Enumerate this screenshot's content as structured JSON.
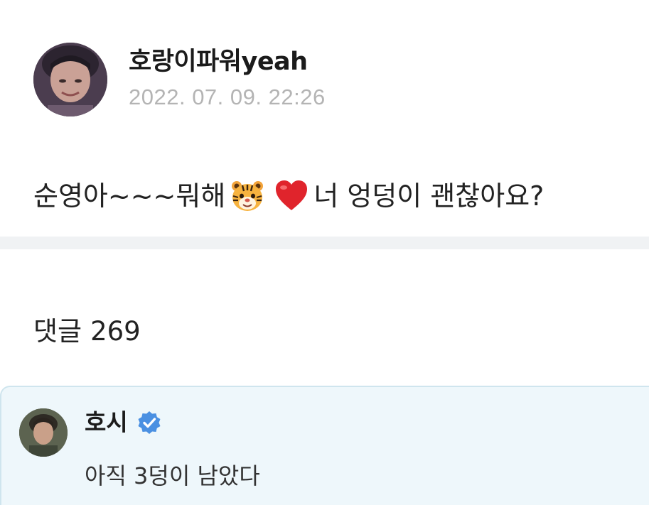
{
  "post": {
    "author": "호랑이파워yeah",
    "date": "2022. 07. 09. 22:26",
    "avatar_icon": "user-avatar-photo",
    "body_start": "순영아~~~뭐해",
    "body_emoji_1": "tiger-face",
    "body_emoji_2": "red-heart",
    "body_end": "너 엉덩이 괜찮아요?"
  },
  "comments": {
    "label": "댓글",
    "count": "269"
  },
  "comment": {
    "author": "호시",
    "verified_icon": "verified-badge-icon",
    "verified_color": "#4a90e2",
    "text": "아직 3덩이 남았다",
    "card_background": "#eef7fb"
  }
}
